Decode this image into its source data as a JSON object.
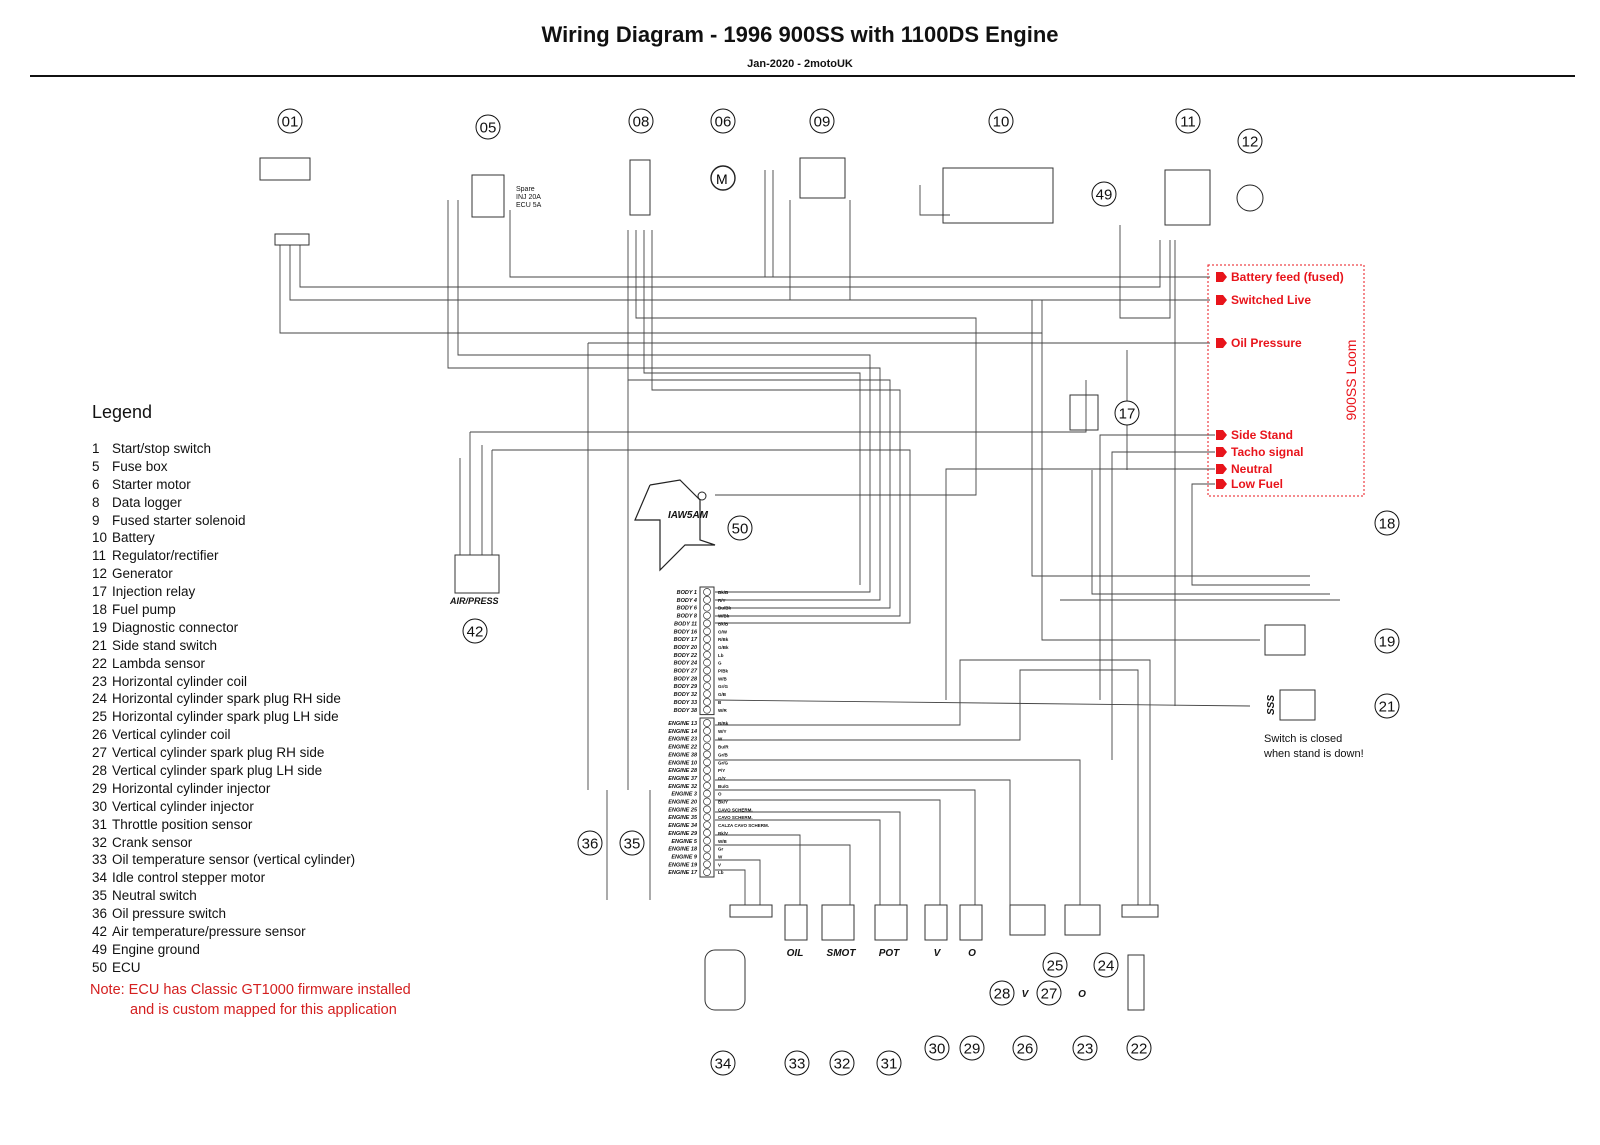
{
  "header": {
    "title": "Wiring Diagram - 1996 900SS with 1100DS Engine",
    "subtitle": "Jan-2020 - 2motoUK"
  },
  "legend": {
    "title": "Legend",
    "items": [
      {
        "num": "1",
        "label": "Start/stop switch"
      },
      {
        "num": "5",
        "label": "Fuse box"
      },
      {
        "num": "6",
        "label": "Starter motor"
      },
      {
        "num": "8",
        "label": "Data logger"
      },
      {
        "num": "9",
        "label": "Fused starter solenoid"
      },
      {
        "num": "10",
        "label": "Battery"
      },
      {
        "num": "11",
        "label": "Regulator/rectifier"
      },
      {
        "num": "12",
        "label": "Generator"
      },
      {
        "num": "17",
        "label": "Injection relay"
      },
      {
        "num": "18",
        "label": "Fuel pump"
      },
      {
        "num": "19",
        "label": "Diagnostic connector"
      },
      {
        "num": "21",
        "label": "Side stand switch"
      },
      {
        "num": "22",
        "label": "Lambda sensor"
      },
      {
        "num": "23",
        "label": "Horizontal cylinder coil"
      },
      {
        "num": "24",
        "label": "Horizontal cylinder spark plug RH side"
      },
      {
        "num": "25",
        "label": "Horizontal cylinder spark plug LH side"
      },
      {
        "num": "26",
        "label": "Vertical cylinder coil"
      },
      {
        "num": "27",
        "label": "Vertical cylinder spark plug RH side"
      },
      {
        "num": "28",
        "label": "Vertical cylinder spark plug LH side"
      },
      {
        "num": "29",
        "label": "Horizontal cylinder injector"
      },
      {
        "num": "30",
        "label": "Vertical cylinder injector"
      },
      {
        "num": "31",
        "label": "Throttle position sensor"
      },
      {
        "num": "32",
        "label": "Crank sensor"
      },
      {
        "num": "33",
        "label": "Oil temperature sensor (vertical cylinder)"
      },
      {
        "num": "34",
        "label": "Idle control stepper motor"
      },
      {
        "num": "35",
        "label": "Neutral switch"
      },
      {
        "num": "36",
        "label": "Oil pressure switch"
      },
      {
        "num": "42",
        "label": "Air temperature/pressure sensor"
      },
      {
        "num": "49",
        "label": "Engine ground"
      },
      {
        "num": "50",
        "label": "ECU"
      }
    ]
  },
  "note": {
    "line1": "Note: ECU has Classic GT1000 firmware installed",
    "line2": "and is custom mapped for this application"
  },
  "components": [
    "01",
    "05",
    "08",
    "06",
    "09",
    "10",
    "11",
    "12",
    "49",
    "17",
    "18",
    "19",
    "21",
    "42",
    "50",
    "36",
    "35",
    "34",
    "33",
    "32",
    "31",
    "30",
    "29",
    "26",
    "23",
    "22",
    "28",
    "27",
    "25",
    "24"
  ],
  "component_labels": {
    "ecu": "IAW5AM",
    "air_press": "AIR/PRESS",
    "sss": "SSS",
    "fuse_box": [
      "Spare",
      "INJ 20A",
      "ECU 5A"
    ],
    "side_stand_note": [
      "Switch is closed",
      "when stand is down!"
    ],
    "sensors": [
      "OIL",
      "SMOT",
      "POT",
      "V",
      "O",
      "V",
      "O"
    ]
  },
  "loom": {
    "title": "900SS Loom",
    "color": "#e8141b",
    "outputs": [
      "Battery feed (fused)",
      "Switched Live",
      "Oil Pressure",
      "Side Stand",
      "Tacho signal",
      "Neutral",
      "Low Fuel"
    ]
  },
  "ecu_pins": {
    "body": [
      {
        "pin": "BODY 1",
        "wire": "Bk/B"
      },
      {
        "pin": "BODY 4",
        "wire": "R/Y"
      },
      {
        "pin": "BODY 6",
        "wire": "Bu/Bk"
      },
      {
        "pin": "BODY 8",
        "wire": "W/Bk"
      },
      {
        "pin": "BODY 11",
        "wire": "Bk/B"
      },
      {
        "pin": "BODY 16",
        "wire": "O/W"
      },
      {
        "pin": "BODY 17",
        "wire": "R/Bk"
      },
      {
        "pin": "BODY 20",
        "wire": "G/Bk"
      },
      {
        "pin": "BODY 22",
        "wire": "Lb"
      },
      {
        "pin": "BODY 24",
        "wire": "G"
      },
      {
        "pin": "BODY 27",
        "wire": "P/Bk"
      },
      {
        "pin": "BODY 28",
        "wire": "W/B"
      },
      {
        "pin": "BODY 29",
        "wire": "Gr/G"
      },
      {
        "pin": "BODY 32",
        "wire": "G/B"
      },
      {
        "pin": "BODY 33",
        "wire": "B"
      },
      {
        "pin": "BODY 38",
        "wire": "W/R"
      }
    ],
    "engine": [
      {
        "pin": "ENGINE 13",
        "wire": "B/Bk"
      },
      {
        "pin": "ENGINE 14",
        "wire": "W/Y"
      },
      {
        "pin": "ENGINE 23",
        "wire": "W"
      },
      {
        "pin": "ENGINE 22",
        "wire": "Bu/R"
      },
      {
        "pin": "ENGINE 38",
        "wire": "Gr/B"
      },
      {
        "pin": "ENGINE 10",
        "wire": "Gr/G"
      },
      {
        "pin": "ENGINE 28",
        "wire": "P/Y"
      },
      {
        "pin": "ENGINE 37",
        "wire": "G/Y"
      },
      {
        "pin": "ENGINE 32",
        "wire": "Bu/G"
      },
      {
        "pin": "ENGINE 3",
        "wire": "O"
      },
      {
        "pin": "ENGINE 20",
        "wire": "Bk/Y"
      },
      {
        "pin": "ENGINE 25",
        "wire": "CAVO SCHERM."
      },
      {
        "pin": "ENGINE 35",
        "wire": "CAVO SCHERM."
      },
      {
        "pin": "ENGINE 34",
        "wire": "CALZA CAVO SCHERM."
      },
      {
        "pin": "ENGINE 29",
        "wire": "Bk/V"
      },
      {
        "pin": "ENGINE 5",
        "wire": "W/B"
      },
      {
        "pin": "ENGINE 18",
        "wire": "Gr"
      },
      {
        "pin": "ENGINE 9",
        "wire": "W"
      },
      {
        "pin": "ENGINE 19",
        "wire": "V"
      },
      {
        "pin": "ENGINE 17",
        "wire": "Lb"
      }
    ]
  }
}
